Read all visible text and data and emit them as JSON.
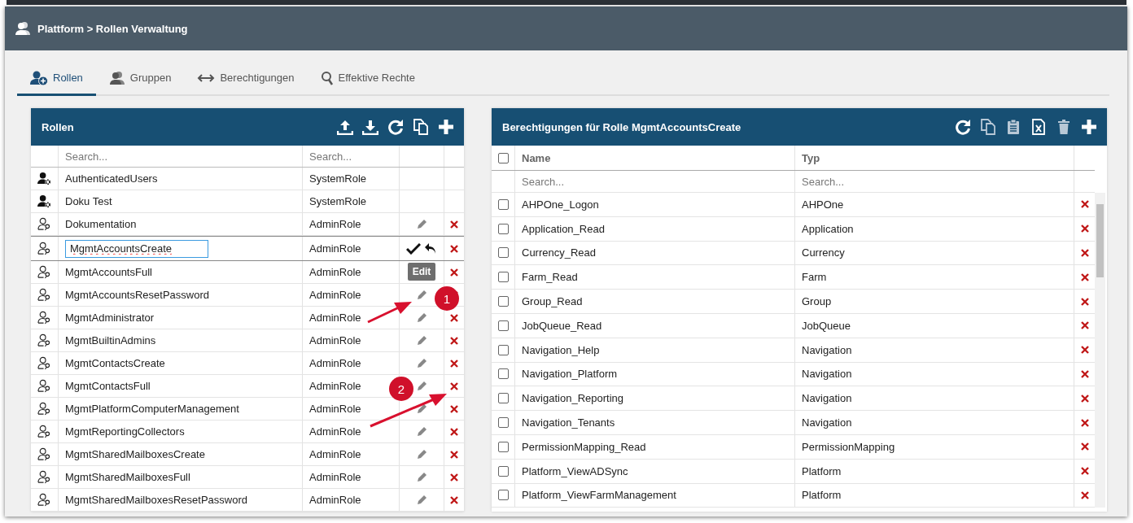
{
  "header": {
    "title": "Plattform > Rollen Verwaltung"
  },
  "tabs": [
    {
      "label": "Rollen",
      "selected": true
    },
    {
      "label": "Gruppen",
      "selected": false
    },
    {
      "label": "Berechtigungen",
      "selected": false
    },
    {
      "label": "Effektive Rechte",
      "selected": false
    }
  ],
  "roles_panel": {
    "title": "Rollen",
    "search_placeholders": [
      "Search...",
      "Search..."
    ],
    "rows": [
      {
        "name": "AuthenticatedUsers",
        "type": "SystemRole",
        "kind": "system",
        "editing": false
      },
      {
        "name": "Doku Test",
        "type": "SystemRole",
        "kind": "system",
        "editing": false
      },
      {
        "name": "Dokumentation",
        "type": "AdminRole",
        "kind": "admin",
        "editing": false
      },
      {
        "name": "MgmtAccountsCreate",
        "type": "AdminRole",
        "kind": "admin",
        "editing": true
      },
      {
        "name": "MgmtAccountsFull",
        "type": "AdminRole",
        "kind": "admin",
        "editing": false
      },
      {
        "name": "MgmtAccountsResetPassword",
        "type": "AdminRole",
        "kind": "admin",
        "editing": false
      },
      {
        "name": "MgmtAdministrator",
        "type": "AdminRole",
        "kind": "admin",
        "editing": false
      },
      {
        "name": "MgmtBuiltinAdmins",
        "type": "AdminRole",
        "kind": "admin",
        "editing": false
      },
      {
        "name": "MgmtContactsCreate",
        "type": "AdminRole",
        "kind": "admin",
        "editing": false
      },
      {
        "name": "MgmtContactsFull",
        "type": "AdminRole",
        "kind": "admin",
        "editing": false
      },
      {
        "name": "MgmtPlatformComputerManagement",
        "type": "AdminRole",
        "kind": "admin",
        "editing": false
      },
      {
        "name": "MgmtReportingCollectors",
        "type": "AdminRole",
        "kind": "admin",
        "editing": false
      },
      {
        "name": "MgmtSharedMailboxesCreate",
        "type": "AdminRole",
        "kind": "admin",
        "editing": false
      },
      {
        "name": "MgmtSharedMailboxesFull",
        "type": "AdminRole",
        "kind": "admin",
        "editing": false
      },
      {
        "name": "MgmtSharedMailboxesResetPassword",
        "type": "AdminRole",
        "kind": "admin",
        "editing": false
      }
    ]
  },
  "edit_tooltip": "Edit",
  "permissions_panel": {
    "title": "Berechtigungen für Rolle MgmtAccountsCreate",
    "columns": [
      "Name",
      "Typ"
    ],
    "all_checked": false,
    "search_placeholders": [
      "Search...",
      "Search..."
    ],
    "rows": [
      {
        "name": "AHPOne_Logon",
        "type": "AHPOne",
        "checked": false
      },
      {
        "name": "Application_Read",
        "type": "Application",
        "checked": false
      },
      {
        "name": "Currency_Read",
        "type": "Currency",
        "checked": false
      },
      {
        "name": "Farm_Read",
        "type": "Farm",
        "checked": false
      },
      {
        "name": "Group_Read",
        "type": "Group",
        "checked": false
      },
      {
        "name": "JobQueue_Read",
        "type": "JobQueue",
        "checked": false
      },
      {
        "name": "Navigation_Help",
        "type": "Navigation",
        "checked": false
      },
      {
        "name": "Navigation_Platform",
        "type": "Navigation",
        "checked": false
      },
      {
        "name": "Navigation_Reporting",
        "type": "Navigation",
        "checked": false
      },
      {
        "name": "Navigation_Tenants",
        "type": "Navigation",
        "checked": false
      },
      {
        "name": "PermissionMapping_Read",
        "type": "PermissionMapping",
        "checked": false
      },
      {
        "name": "Platform_ViewADSync",
        "type": "Platform",
        "checked": false
      },
      {
        "name": "Platform_ViewFarmManagement",
        "type": "Platform",
        "checked": false
      }
    ]
  },
  "annotations": [
    {
      "label": "1"
    },
    {
      "label": "2"
    }
  ]
}
